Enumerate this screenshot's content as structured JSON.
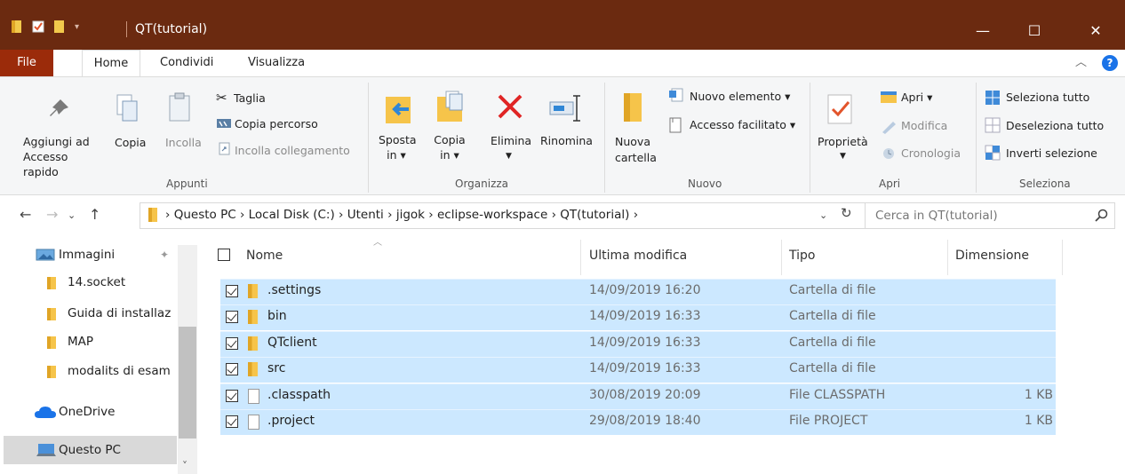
{
  "window": {
    "title": "QT(tutorial)",
    "minimize_glyph": "—",
    "maximize_glyph": "☐",
    "close_glyph": "✕"
  },
  "ribbon_tabs": [
    "File",
    "Home",
    "Condividi",
    "Visualizza"
  ],
  "ribbon": {
    "appunti": {
      "label": "Appunti",
      "pin": "Aggiungi ad Accesso rapido",
      "copy": "Copia",
      "paste": "Incolla",
      "cut": "Taglia",
      "copy_path": "Copia percorso",
      "paste_link": "Incolla collegamento"
    },
    "organizza": {
      "label": "Organizza",
      "move": "Sposta in",
      "copy_to": "Copia in",
      "delete": "Elimina",
      "rename": "Rinomina"
    },
    "nuovo": {
      "label": "Nuovo",
      "new_folder": "Nuova cartella",
      "new_item": "Nuovo elemento",
      "easy_access": "Accesso facilitato"
    },
    "apri": {
      "label": "Apri",
      "properties": "Proprietà",
      "open": "Apri",
      "edit": "Modifica",
      "history": "Cronologia"
    },
    "seleziona": {
      "label": "Seleziona",
      "select_all": "Seleziona tutto",
      "select_none": "Deseleziona tutto",
      "invert": "Inverti selezione"
    }
  },
  "breadcrumb": [
    "Questo PC",
    "Local Disk (C:)",
    "Utenti",
    "jigok",
    "eclipse-workspace",
    "QT(tutorial)"
  ],
  "search": {
    "placeholder": "Cerca in QT(tutorial)"
  },
  "nav_pane": [
    {
      "label": "Immagini",
      "icon": "pictures-icon"
    },
    {
      "label": "14.socket",
      "icon": "folder-icon"
    },
    {
      "label": "Guida di installaz",
      "icon": "folder-icon"
    },
    {
      "label": "MAP",
      "icon": "folder-icon"
    },
    {
      "label": "modalits di esam",
      "icon": "folder-icon"
    },
    {
      "label": "OneDrive",
      "icon": "cloud-icon"
    },
    {
      "label": "Questo PC",
      "icon": "computer-icon"
    }
  ],
  "columns": {
    "name": "Nome",
    "modified": "Ultima modifica",
    "type": "Tipo",
    "size": "Dimensione"
  },
  "files": [
    {
      "name": ".settings",
      "modified": "14/09/2019 16:20",
      "type": "Cartella di file",
      "size": "",
      "kind": "folder"
    },
    {
      "name": "bin",
      "modified": "14/09/2019 16:33",
      "type": "Cartella di file",
      "size": "",
      "kind": "folder"
    },
    {
      "name": "QTclient",
      "modified": "14/09/2019 16:33",
      "type": "Cartella di file",
      "size": "",
      "kind": "folder"
    },
    {
      "name": "src",
      "modified": "14/09/2019 16:33",
      "type": "Cartella di file",
      "size": "",
      "kind": "folder"
    },
    {
      "name": ".classpath",
      "modified": "30/08/2019 20:09",
      "type": "File CLASSPATH",
      "size": "1 KB",
      "kind": "file"
    },
    {
      "name": ".project",
      "modified": "29/08/2019 18:40",
      "type": "File PROJECT",
      "size": "1 KB",
      "kind": "file"
    }
  ],
  "colors": {
    "titlebar": "#6b2a10",
    "file_tab": "#9b2b0a",
    "selection": "#cce8ff",
    "accent": "#1a73e8"
  }
}
